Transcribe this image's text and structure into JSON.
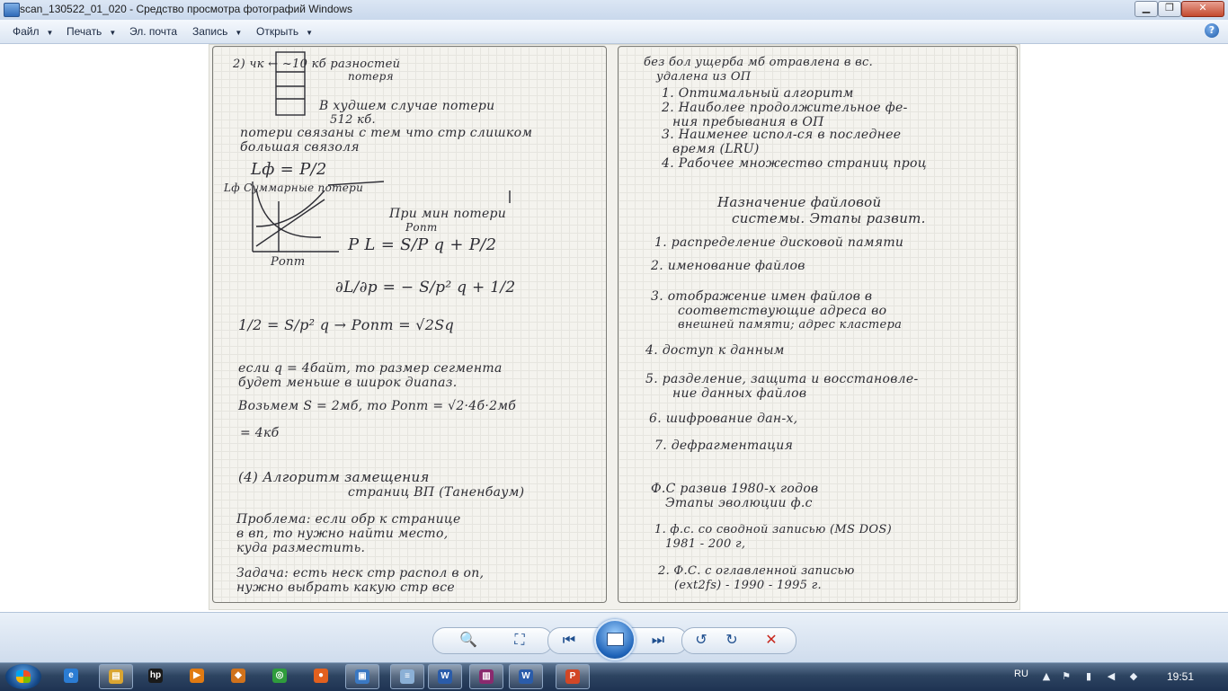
{
  "window": {
    "title": "scan_130522_01_020 - Средство просмотра фотографий Windows",
    "controls": {
      "minimize": "▁",
      "maximize": "❐",
      "close": "✕"
    }
  },
  "menu": {
    "items": [
      {
        "label": "Файл",
        "dropdown": true
      },
      {
        "label": "Печать",
        "dropdown": true
      },
      {
        "label": "Эл. почта",
        "dropdown": false
      },
      {
        "label": "Запись",
        "dropdown": true
      },
      {
        "label": "Открыть",
        "dropdown": true
      }
    ],
    "help_glyph": "?"
  },
  "scan": {
    "left_page": [
      "2) чк          ← ~10 кб разностей",
      "                 потеря",
      "В худшем случае потери",
      "512 кб.",
      "потери связаны с тем что стр слишком",
      "большая связоля",
      "Lф = P/2",
      "Lф                Суммарные потери",
      "При мин потери",
      "Ропт",
      "P      L = S/P q + P/2",
      "Pопт",
      "∂L/∂p = − S/p² q + 1/2",
      "1/2 = S/p² q → Pопт = √2Sq",
      "если  q = 4байт, то размер сегмента",
      "будет меньше в широк диапаз.",
      "Возьмем  S = 2мб, то Pопт = √2·4б·2мб",
      "= 4кб",
      "(4) Алгоритм замещения",
      "страниц ВП  (Таненбаум)",
      "Проблема: если обр к странице",
      "в вп, то нужно найти место,",
      "куда разместить.",
      "Задача: есть неск стр распол в оп,",
      "нужно выбрать какую стр все"
    ],
    "right_page": [
      "без бол ущерба мб отравлена в вс.",
      "удалена из ОП",
      "1. Оптимальный алгоритм",
      "2. Наиболее продолжительное фе-",
      "ния пребывания в ОП",
      "3. Наименее испол-ся в последнее",
      "время (LRU)",
      "4. Рабочее множество страниц проц",
      "Назначение файловой",
      "системы. Этапы развит.",
      "1. распределение дисковой памяти",
      "2. именование файлов",
      "3. отображение имен файлов в",
      "соответствующие адреса во",
      "внешней памяти; адрес кластера",
      "4. доступ к данным",
      "5. разделение, защита и восстановле-",
      "ние данных файлов",
      "6. шифрование дан-х,",
      "7. дефрагментация",
      "Ф.С развив 1980-х годов",
      "Этапы эволюции ф.с",
      "1. ф.с. со сводной записью (MS DOS)",
      "1981 - 200 г,",
      "2. Ф.С. с оглавленной записью",
      "(ext2fs) - 1990 - 1995 г."
    ]
  },
  "toolbar": {
    "zoom": "🔍",
    "fit": "⛶",
    "previous": "⏮",
    "next": "⏭",
    "rotate_left": "↺",
    "rotate_right": "↻",
    "delete": "✕"
  },
  "taskbar": {
    "language": "RU",
    "clock": "19:51",
    "apps": [
      {
        "name": "ie",
        "glyph": "e",
        "color": "#2b7cd3"
      },
      {
        "name": "explorer",
        "glyph": "▤",
        "color": "#d9a532"
      },
      {
        "name": "hp",
        "glyph": "hp",
        "color": "#1a1a1a"
      },
      {
        "name": "media-player",
        "glyph": "▶",
        "color": "#e07a12"
      },
      {
        "name": "flashget",
        "glyph": "◆",
        "color": "#d0721c"
      },
      {
        "name": "chrome",
        "glyph": "◎",
        "color": "#2f9c3c"
      },
      {
        "name": "firefox",
        "glyph": "●",
        "color": "#e2601e"
      },
      {
        "name": "photo-viewer",
        "glyph": "▣",
        "color": "#3a78c2"
      },
      {
        "name": "notepad",
        "glyph": "≡",
        "color": "#8bb0d6"
      },
      {
        "name": "word",
        "glyph": "W",
        "color": "#2a5caa"
      },
      {
        "name": "winrar",
        "glyph": "▥",
        "color": "#8a2a6e"
      },
      {
        "name": "word-2",
        "glyph": "W",
        "color": "#2a5caa"
      },
      {
        "name": "powerpoint",
        "glyph": "P",
        "color": "#d24726"
      }
    ]
  },
  "colors": {
    "accent": "#1e5aa8",
    "taskbar": "#2d4461",
    "page": "#f4f3ee"
  }
}
